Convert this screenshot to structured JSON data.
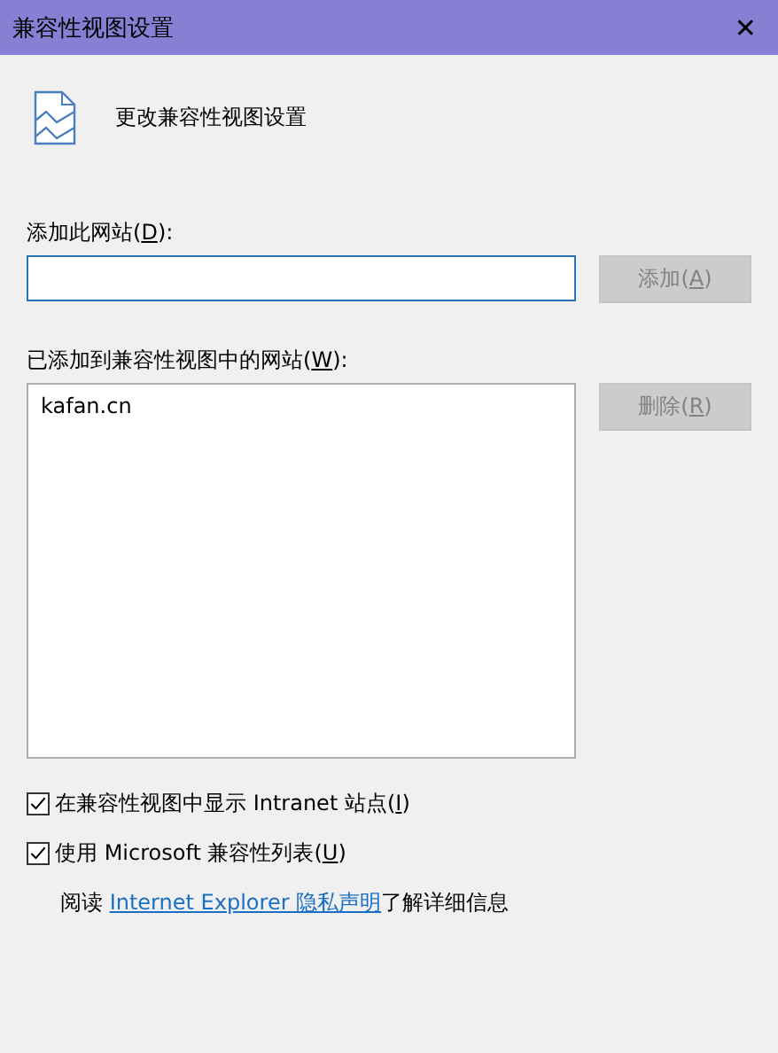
{
  "window": {
    "title": "兼容性视图设置",
    "close": "✕"
  },
  "heading": "更改兼容性视图设置",
  "add_site": {
    "label": {
      "before": "添加此网站(",
      "key": "D",
      "after": "):"
    },
    "button": {
      "before": "添加(",
      "key": "A",
      "after": ")",
      "disabled": true
    }
  },
  "sites": {
    "label": {
      "before": "已添加到兼容性视图中的网站(",
      "key": "W",
      "after": "):"
    },
    "items": [
      {
        "text": "kafan.cn",
        "selected": false
      }
    ],
    "button": {
      "before": "删除(",
      "key": "R",
      "after": ")",
      "disabled": true
    }
  },
  "options": [
    {
      "before": "在兼容性视图中显示 Intranet 站点(",
      "key": "I",
      "after": ")",
      "checked": true
    },
    {
      "before": "使用 Microsoft 兼容性列表(",
      "key": "U",
      "after": ")",
      "checked": true
    }
  ],
  "info": {
    "before": "阅读 ",
    "link": "Internet Explorer 隐私声明",
    "after": "了解详细信息"
  }
}
